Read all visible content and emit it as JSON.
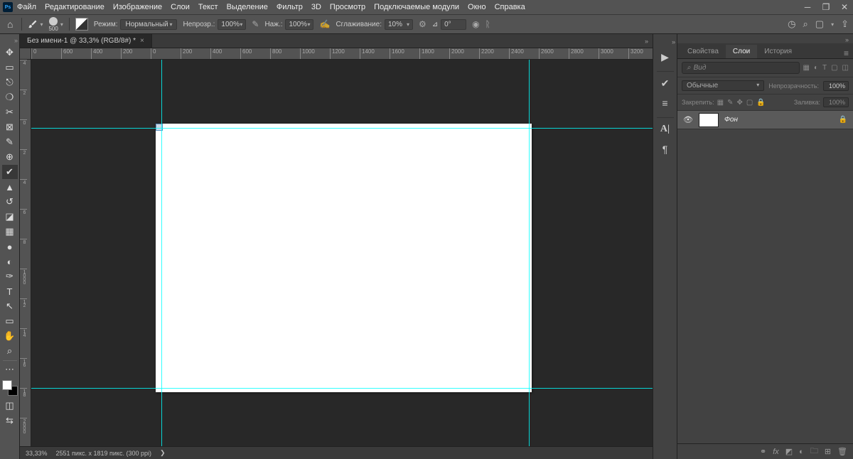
{
  "menubar": {
    "items": [
      "Файл",
      "Редактирование",
      "Изображение",
      "Слои",
      "Текст",
      "Выделение",
      "Фильтр",
      "3D",
      "Просмотр",
      "Подключаемые модули",
      "Окно",
      "Справка"
    ]
  },
  "options": {
    "brush_size": "500",
    "mode_label": "Режим:",
    "mode_value": "Нормальный",
    "opacity_label": "Непрозр.:",
    "opacity_value": "100%",
    "flow_label": "Наж.:",
    "flow_value": "100%",
    "smoothing_label": "Сглаживание:",
    "smoothing_value": "10%",
    "angle_value": "0°"
  },
  "document": {
    "tab_title": "Без имени-1 @ 33,3% (RGB/8#) *",
    "ruler_h": [
      "0",
      "600",
      "400",
      "200",
      "0",
      "200",
      "400",
      "600",
      "800",
      "1000",
      "1200",
      "1400",
      "1600",
      "1800",
      "2000",
      "2200",
      "2400",
      "2600",
      "2800",
      "3000",
      "3200"
    ],
    "ruler_v": [
      "4",
      "2",
      "0",
      "2",
      "4",
      "6",
      "8",
      "1000",
      "12",
      "14",
      "16",
      "18",
      "2000"
    ],
    "slice_num": "01"
  },
  "statusbar": {
    "zoom": "33,33%",
    "info": "2551 пикс. x 1819 пикс. (300 ppi)",
    "arrow": "❯"
  },
  "panels": {
    "tabs": {
      "properties": "Свойства",
      "layers": "Слои",
      "history": "История"
    },
    "search_placeholder": "Вид",
    "blend_mode": "Обычные",
    "opacity_label": "Непрозрачность:",
    "opacity_value": "100%",
    "lock_label": "Закрепить:",
    "fill_label": "Заливка:",
    "fill_value": "100%",
    "layer_name": "Фон"
  }
}
